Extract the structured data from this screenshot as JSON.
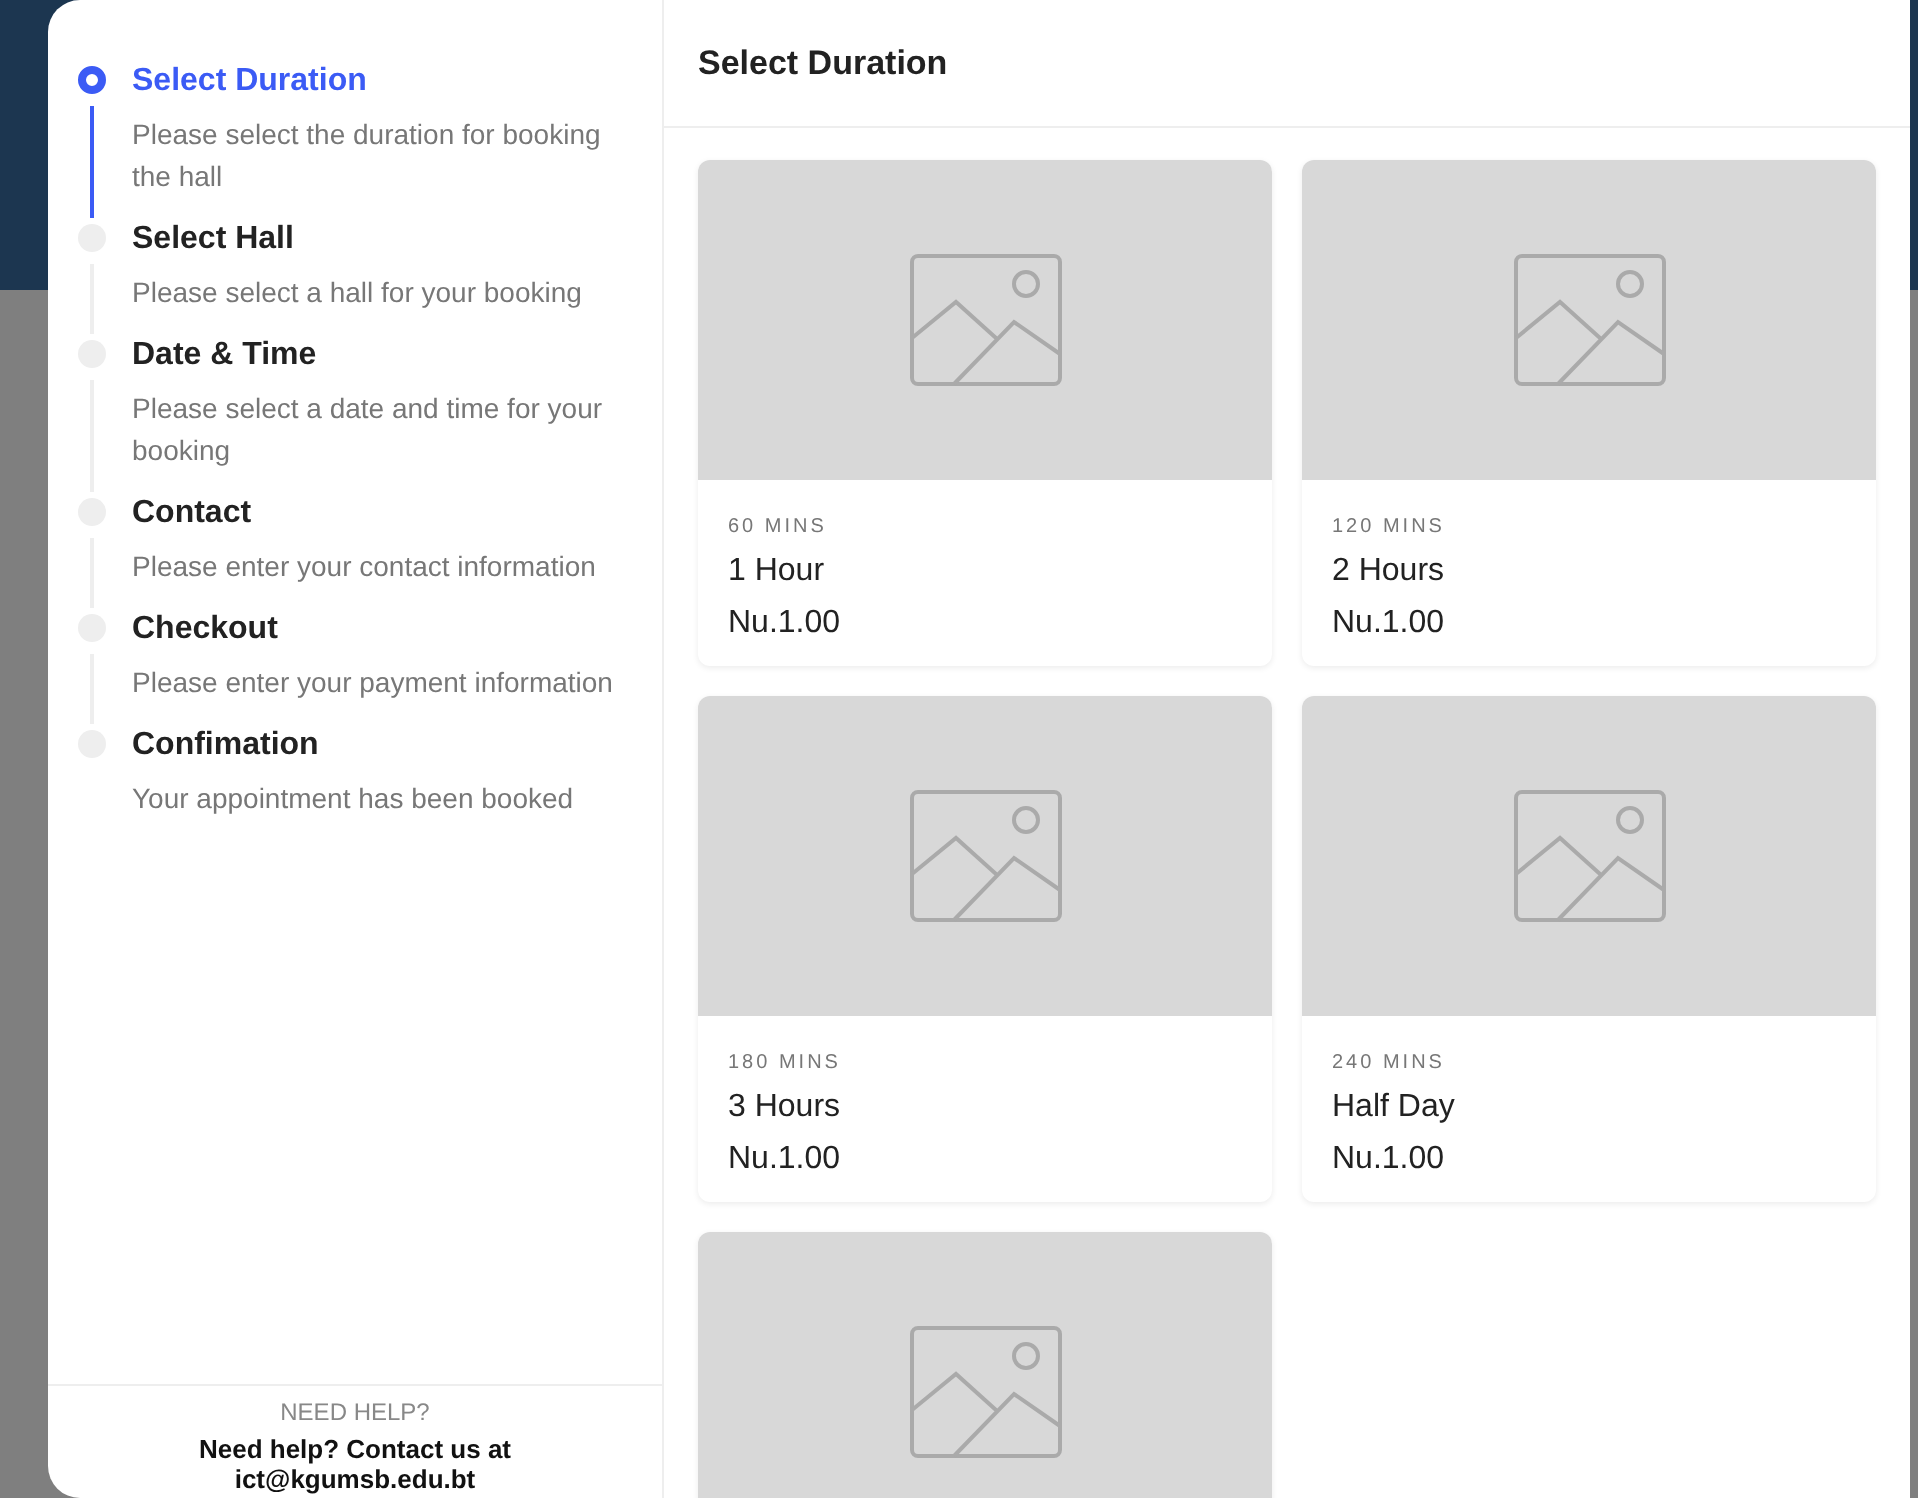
{
  "steps": [
    {
      "title": "Select Duration",
      "description": "Please select the duration for booking the hall",
      "selected": true
    },
    {
      "title": "Select Hall",
      "description": "Please select a hall for your booking",
      "selected": false
    },
    {
      "title": "Date & Time",
      "description": "Please select a date and time for your booking",
      "selected": false
    },
    {
      "title": "Contact",
      "description": "Please enter your contact information",
      "selected": false
    },
    {
      "title": "Checkout",
      "description": "Please enter your payment information",
      "selected": false
    },
    {
      "title": "Confimation",
      "description": "Your appointment has been booked",
      "selected": false
    }
  ],
  "help": {
    "heading": "NEED HELP?",
    "text": "Need help? Contact us at ict@kgumsb.edu.bt"
  },
  "main": {
    "title": "Select Duration",
    "cards": [
      {
        "kind": "duration",
        "duration": "60 MINS",
        "name": "1 Hour",
        "price": "Nu.1.00"
      },
      {
        "kind": "duration",
        "duration": "120 MINS",
        "name": "2 Hours",
        "price": "Nu.1.00"
      },
      {
        "kind": "duration",
        "duration": "180 MINS",
        "name": "3 Hours",
        "price": "Nu.1.00"
      },
      {
        "kind": "duration",
        "duration": "240 MINS",
        "name": "Half Day",
        "price": "Nu.1.00"
      },
      {
        "kind": "picture"
      }
    ]
  }
}
